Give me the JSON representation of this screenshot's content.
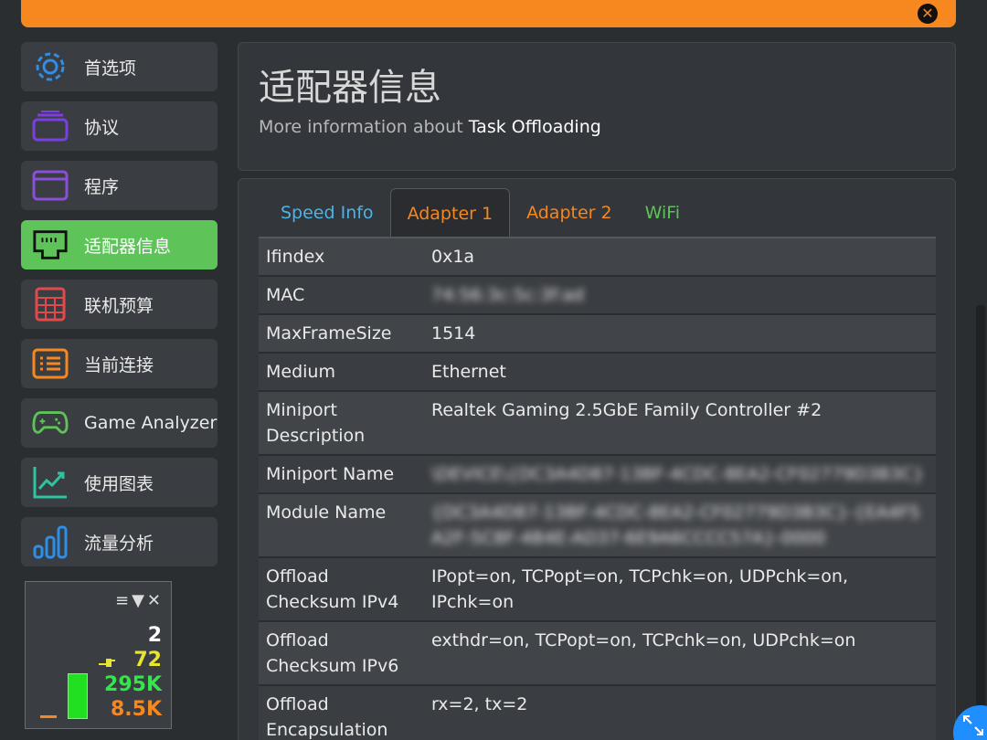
{
  "window": {
    "close_icon": "close-x-icon"
  },
  "sidebar": {
    "items": [
      {
        "label": "首选项",
        "icon": "gear-icon",
        "color": "#2f8fe8"
      },
      {
        "label": "协议",
        "icon": "layers-icon",
        "color": "#7a3fe0"
      },
      {
        "label": "程序",
        "icon": "window-icon",
        "color": "#8a4fd8"
      },
      {
        "label": "适配器信息",
        "icon": "ethernet-port-icon",
        "color": "#ffffff"
      },
      {
        "label": "联机预算",
        "icon": "calculator-icon",
        "color": "#e04a4a"
      },
      {
        "label": "当前连接",
        "icon": "list-icon",
        "color": "#f7871f"
      },
      {
        "label": "Game Analyzer",
        "icon": "gamepad-icon",
        "color": "#5ec45a"
      },
      {
        "label": "使用图表",
        "icon": "line-chart-icon",
        "color": "#2ec4a0"
      },
      {
        "label": "流量分析",
        "icon": "bar-chart-icon",
        "color": "#2f8fe8"
      }
    ],
    "active_index": 3
  },
  "mini_widget": {
    "value1": "2",
    "value2": "72",
    "value3": "295K",
    "value4": "8.5K"
  },
  "header": {
    "title": "适配器信息",
    "sub_prefix": "More information about",
    "sub_strong": "Task Offloading"
  },
  "tabs": [
    {
      "label": "Speed Info"
    },
    {
      "label": "Adapter 1"
    },
    {
      "label": "Adapter 2"
    },
    {
      "label": "WiFi"
    }
  ],
  "active_tab": 1,
  "table": {
    "rows": [
      {
        "key": "Ifindex",
        "value": "0x1a"
      },
      {
        "key": "MAC",
        "value": "74:56:3c:5c:3f:ad"
      },
      {
        "key": "MaxFrameSize",
        "value": "1514"
      },
      {
        "key": "Medium",
        "value": "Ethernet"
      },
      {
        "key": "Miniport Description",
        "value": "Realtek Gaming 2.5GbE Family Controller #2"
      },
      {
        "key": "Miniport Name",
        "value": "\\DEVICE\\{DC3A4D87-13BF-4CDC-8EA2-CF02779D3B3C}"
      },
      {
        "key": "Module Name",
        "value": "{DC3A4D87-13BF-4CDC-8EA2-CF02779D3B3C}-{EA4F5A2F-5C8F-4B4E-AD37-6E9A6CCCC57A}-0000"
      },
      {
        "key": "Offload Checksum IPv4",
        "value": "IPopt=on, TCPopt=on, TCPchk=on, UDPchk=on, IPchk=on"
      },
      {
        "key": "Offload Checksum IPv6",
        "value": "exthdr=on, TCPopt=on, TCPchk=on, UDPchk=on"
      },
      {
        "key": "Offload Encapsulation",
        "value": "rx=2, tx=2"
      }
    ]
  }
}
